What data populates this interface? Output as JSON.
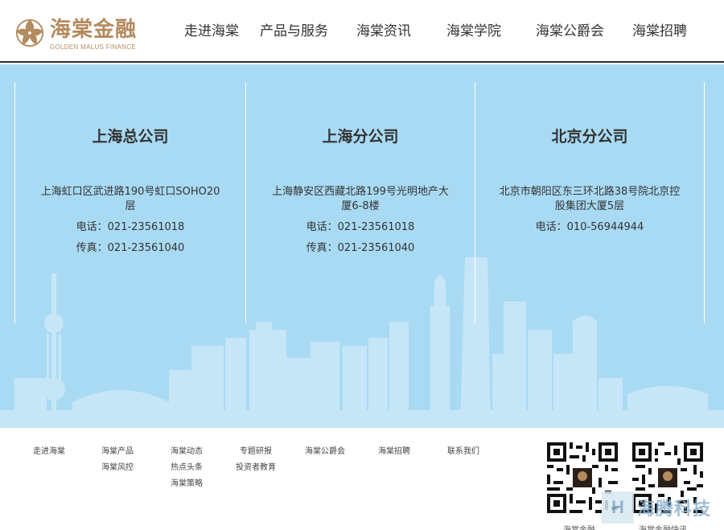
{
  "header": {
    "logo": {
      "cn": "海棠金融",
      "en": "GOLDEN MALUS FINANCE"
    },
    "nav": [
      {
        "label": "走进海棠"
      },
      {
        "label": "产品与服务"
      },
      {
        "label": "海棠资讯"
      },
      {
        "label": "海棠学院"
      },
      {
        "label": "海棠公爵会"
      },
      {
        "label": "海棠招聘"
      }
    ]
  },
  "offices": [
    {
      "title": "上海总公司",
      "address": "上海虹口区武进路190号虹口SOHO20层",
      "phone": "电话：021-23561018",
      "fax": "传真：021-23561040"
    },
    {
      "title": "上海分公司",
      "address": "上海静安区西藏北路199号光明地产大厦6-8楼",
      "phone": "电话：021-23561018",
      "fax": "传真：021-23561040"
    },
    {
      "title": "北京分公司",
      "address": "北京市朝阳区东三环北路38号院北京控股集团大厦5层",
      "phone": "电话：010-56944944"
    }
  ],
  "footer": {
    "columns": [
      [
        "走进海棠"
      ],
      [
        "海棠产品",
        "海棠风控"
      ],
      [
        "海棠动态",
        "热点头条",
        "海棠策略"
      ],
      [
        "专题研报",
        "投资者教育"
      ],
      [
        "海棠公爵会"
      ],
      [
        "海棠招聘"
      ],
      [
        "联系我们"
      ]
    ],
    "qr_labels": [
      "海棠金融",
      "海棠金融快讯"
    ]
  },
  "watermark": {
    "mark": "H",
    "text": "海腾科技"
  },
  "colors": {
    "brand_gold": "#b48a5f",
    "main_bg": "#a9daf3",
    "skyline": "#c6e6f7"
  }
}
